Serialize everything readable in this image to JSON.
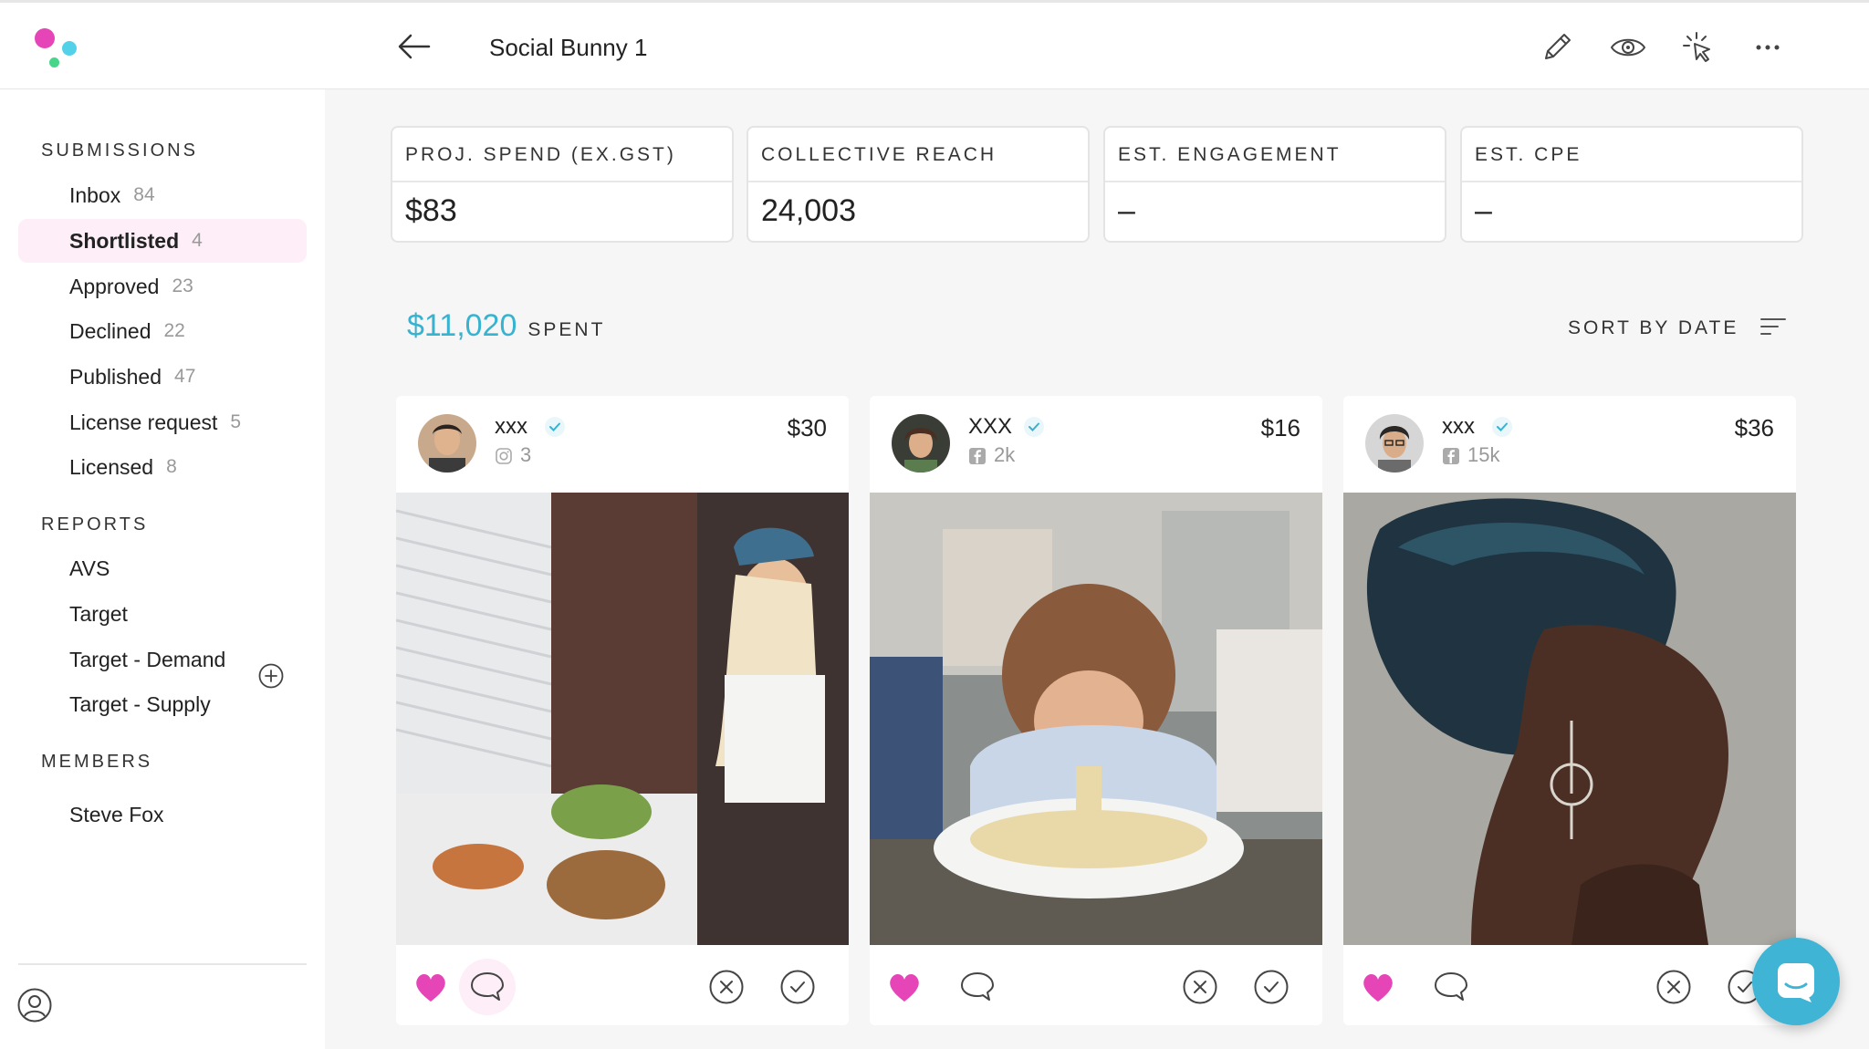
{
  "header": {
    "title": "Social Bunny 1",
    "icons": [
      "back-arrow-icon",
      "pencil-icon",
      "eye-icon",
      "click-icon",
      "more-icon"
    ]
  },
  "sidebar": {
    "submissions_title": "SUBMISSIONS",
    "submissions": [
      {
        "label": "Inbox",
        "count": "84"
      },
      {
        "label": "Shortlisted",
        "count": "4"
      },
      {
        "label": "Approved",
        "count": "23"
      },
      {
        "label": "Declined",
        "count": "22"
      },
      {
        "label": "Published",
        "count": "47"
      },
      {
        "label": "License request",
        "count": "5"
      },
      {
        "label": "Licensed",
        "count": "8"
      }
    ],
    "reports_title": "REPORTS",
    "reports": [
      {
        "label": "AVS"
      },
      {
        "label": "Target"
      },
      {
        "label": "Target - Demand"
      },
      {
        "label": "Target - Supply"
      }
    ],
    "members_title": "MEMBERS",
    "members": [
      {
        "label": "Steve Fox"
      }
    ]
  },
  "stats": [
    {
      "label": "PROJ. SPEND (EX.GST)",
      "value": "$83"
    },
    {
      "label": "COLLECTIVE REACH",
      "value": "24,003"
    },
    {
      "label": "EST. ENGAGEMENT",
      "value": "–"
    },
    {
      "label": "EST. CPE",
      "value": "–"
    }
  ],
  "spent": {
    "amount": "$11,020",
    "label": "SPENT"
  },
  "sort": {
    "label": "SORT BY DATE"
  },
  "cards": [
    {
      "name": "xxx",
      "network": "instagram-icon",
      "followers": "3",
      "price": "$30",
      "liked": true
    },
    {
      "name": "XXX",
      "network": "facebook-icon",
      "followers": "2k",
      "price": "$16",
      "liked": true
    },
    {
      "name": "xxx",
      "network": "facebook-icon",
      "followers": "15k",
      "price": "$36",
      "liked": true
    }
  ],
  "colors": {
    "accent": "#35b3d0",
    "heart": "#e545b7",
    "active_bg": "#fdeef7",
    "fab": "#3fb4d4"
  }
}
